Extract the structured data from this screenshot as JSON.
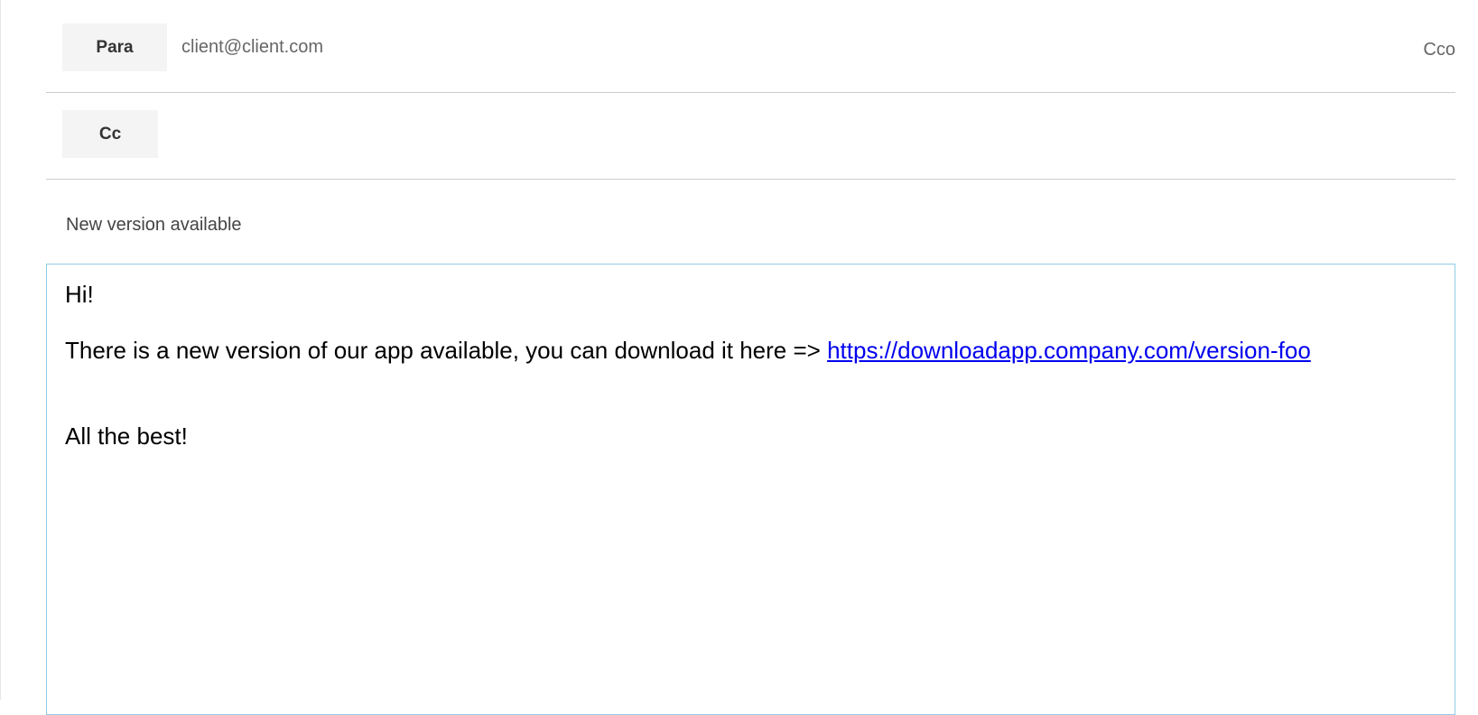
{
  "header": {
    "to_label": "Para",
    "to_value": "client@client.com",
    "bcc_label": "Cco",
    "cc_label": "Cc",
    "cc_value": ""
  },
  "subject": {
    "value": "New version available"
  },
  "body": {
    "greeting": "Hi!",
    "message": "There is a new version of our app available, you can download it here => ",
    "link_text": "https://downloadapp.company.com/version-foo",
    "closing": "All the best!"
  },
  "colors": {
    "body_border": "#8fcde6",
    "link": "#0000ee",
    "divider": "#cccccc",
    "button_bg": "#f4f4f4"
  }
}
